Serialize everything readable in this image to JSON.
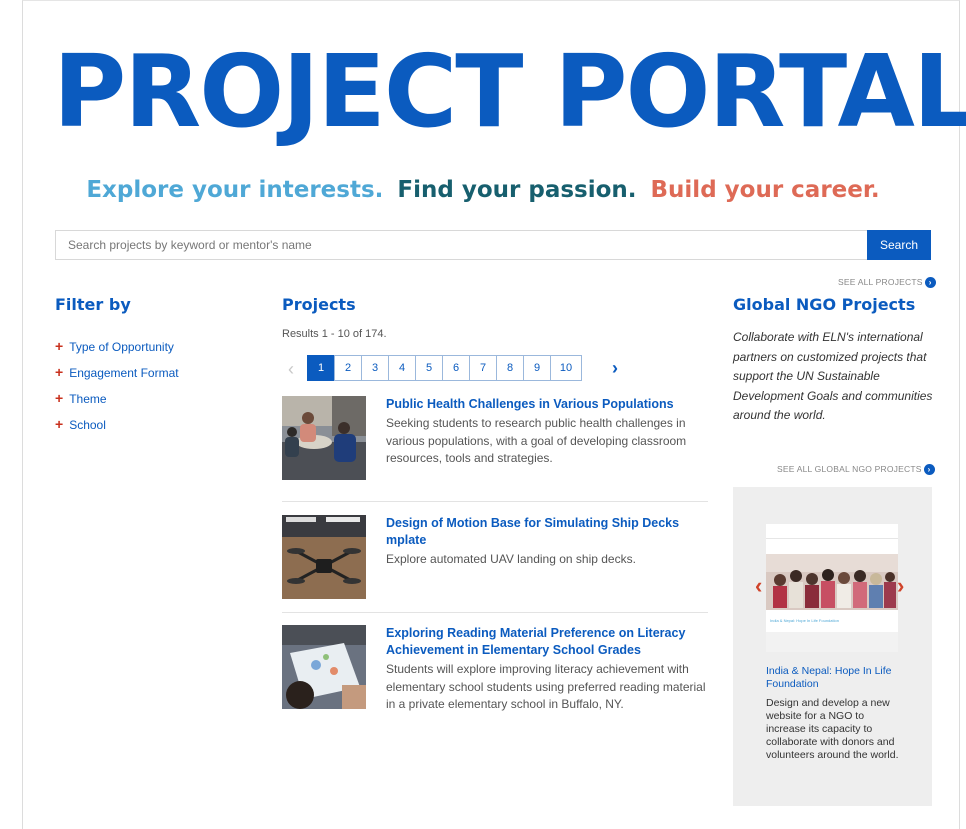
{
  "header": {
    "title": "PROJECT PORTAL",
    "tagline": [
      "Explore your interests.",
      "Find your passion.",
      "Build your career."
    ]
  },
  "search": {
    "placeholder": "Search projects by keyword or mentor's name",
    "value": "",
    "button_label": "Search"
  },
  "see_all_projects": "SEE ALL PROJECTS",
  "filter": {
    "heading": "Filter by",
    "items": [
      "Type of Opportunity",
      "Engagement Format",
      "Theme",
      "School"
    ]
  },
  "projects": {
    "heading": "Projects",
    "results": "Results 1 - 10 of 174.",
    "pagination": {
      "pages": [
        "1",
        "2",
        "3",
        "4",
        "5",
        "6",
        "7",
        "8",
        "9",
        "10"
      ],
      "current": "1",
      "prev": "‹",
      "next": "›"
    },
    "items": [
      {
        "title": "Public Health Challenges in Various Populations",
        "description": "Seeking students to research public health challenges in various populations, with a goal of developing classroom resources, tools and strategies."
      },
      {
        "title": "Design of Motion Base for Simulating Ship Decks mplate",
        "description": "Explore automated UAV landing on ship decks."
      },
      {
        "title": "Exploring Reading Material Preference on Literacy Achievement in Elementary School Grades",
        "description": "Students will explore improving literacy achievement with elementary school students using preferred reading material in a private elementary school in Buffalo, NY."
      }
    ]
  },
  "ngo": {
    "heading": "Global NGO Projects",
    "description": "Collaborate with ELN's international partners on customized projects that support the UN Sustainable Development Goals and communities around the world.",
    "see_all": "SEE ALL GLOBAL NGO PROJECTS",
    "card": {
      "title": "India & Nepal: Hope In Life Foundation",
      "description": "Design and develop a new website for a NGO to increase its capacity to collaborate with donors and volunteers around the world.",
      "prev": "‹",
      "next": "›"
    }
  },
  "colors": {
    "brand_blue": "#0b5bbf",
    "accent_red": "#c8311e",
    "tag_light_blue": "#4fa8d6",
    "tag_teal": "#175f6e",
    "tag_coral": "#de6a56"
  },
  "icons": {
    "see_all": "circle-arrow-right-icon",
    "filter_expand": "plus-icon"
  }
}
